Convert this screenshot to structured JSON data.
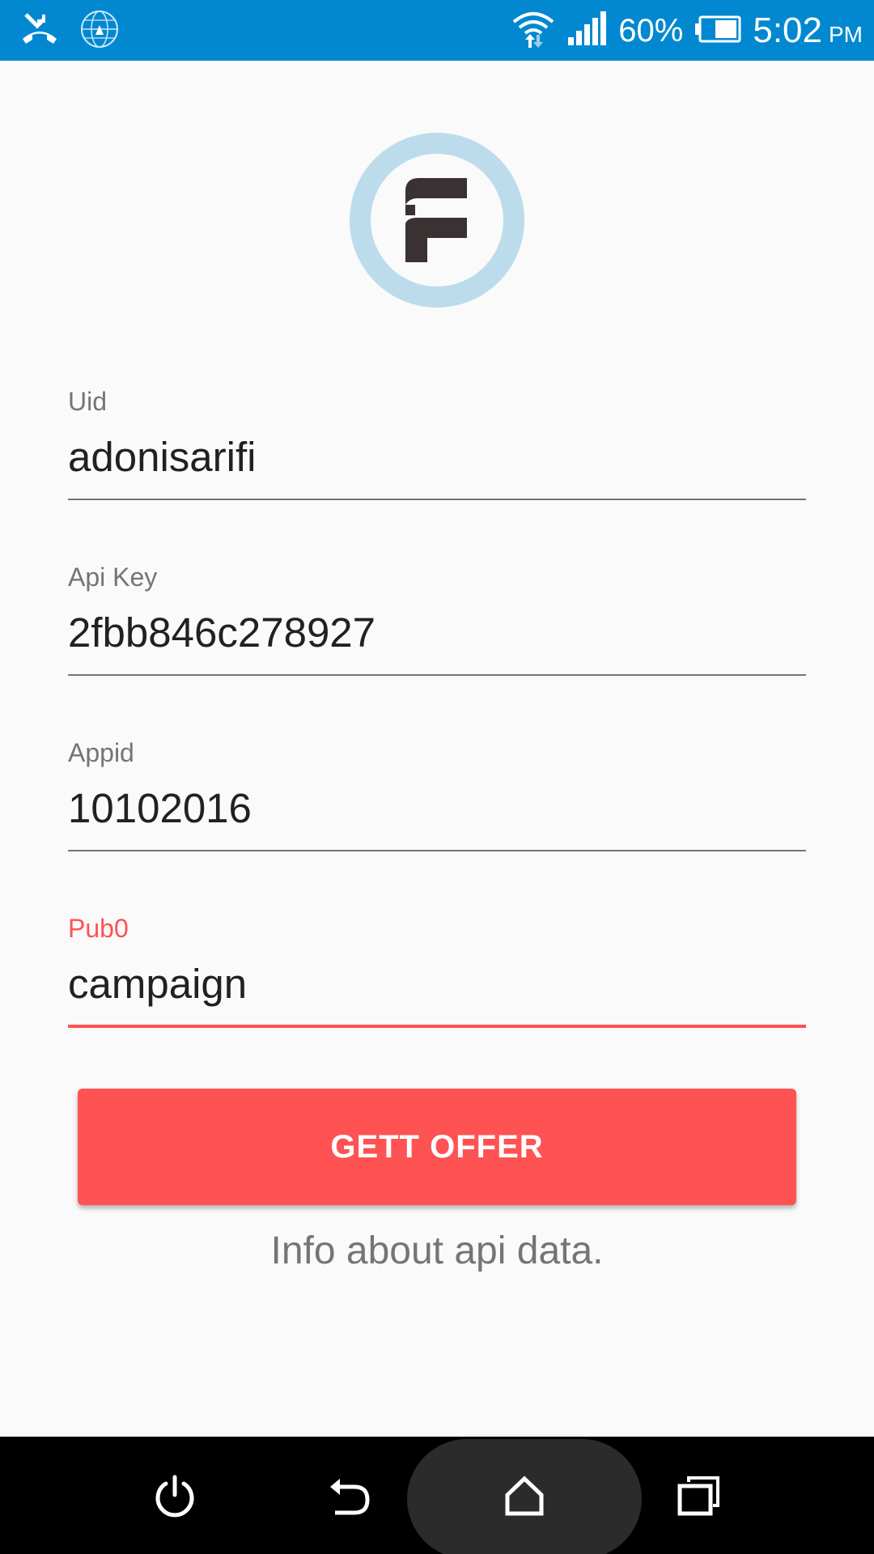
{
  "status_bar": {
    "battery_percent": "60%",
    "time": "5:02",
    "ampm": "PM",
    "icons": [
      "missed-call-icon",
      "vpn-globe-icon",
      "wifi-icon",
      "signal-icon",
      "battery-icon"
    ],
    "color": "#0288d1"
  },
  "logo": {
    "icon": "app-logo-f-icon",
    "ring_color": "#bcdcec",
    "glyph_color": "#3a3232"
  },
  "form": {
    "uid": {
      "label": "Uid",
      "value": "adonisarifi"
    },
    "api_key": {
      "label": "Api Key",
      "value": "2fbb846c278927"
    },
    "appid": {
      "label": "Appid",
      "value": "10102016"
    },
    "pub0": {
      "label": "Pub0",
      "value": "campaign",
      "focused": true
    }
  },
  "button": {
    "label": "GETT OFFER",
    "color": "#ff5252"
  },
  "info_text": "Info about api data.",
  "nav_bar": {
    "icons": [
      "power-icon",
      "back-icon",
      "home-icon",
      "recents-icon"
    ]
  }
}
